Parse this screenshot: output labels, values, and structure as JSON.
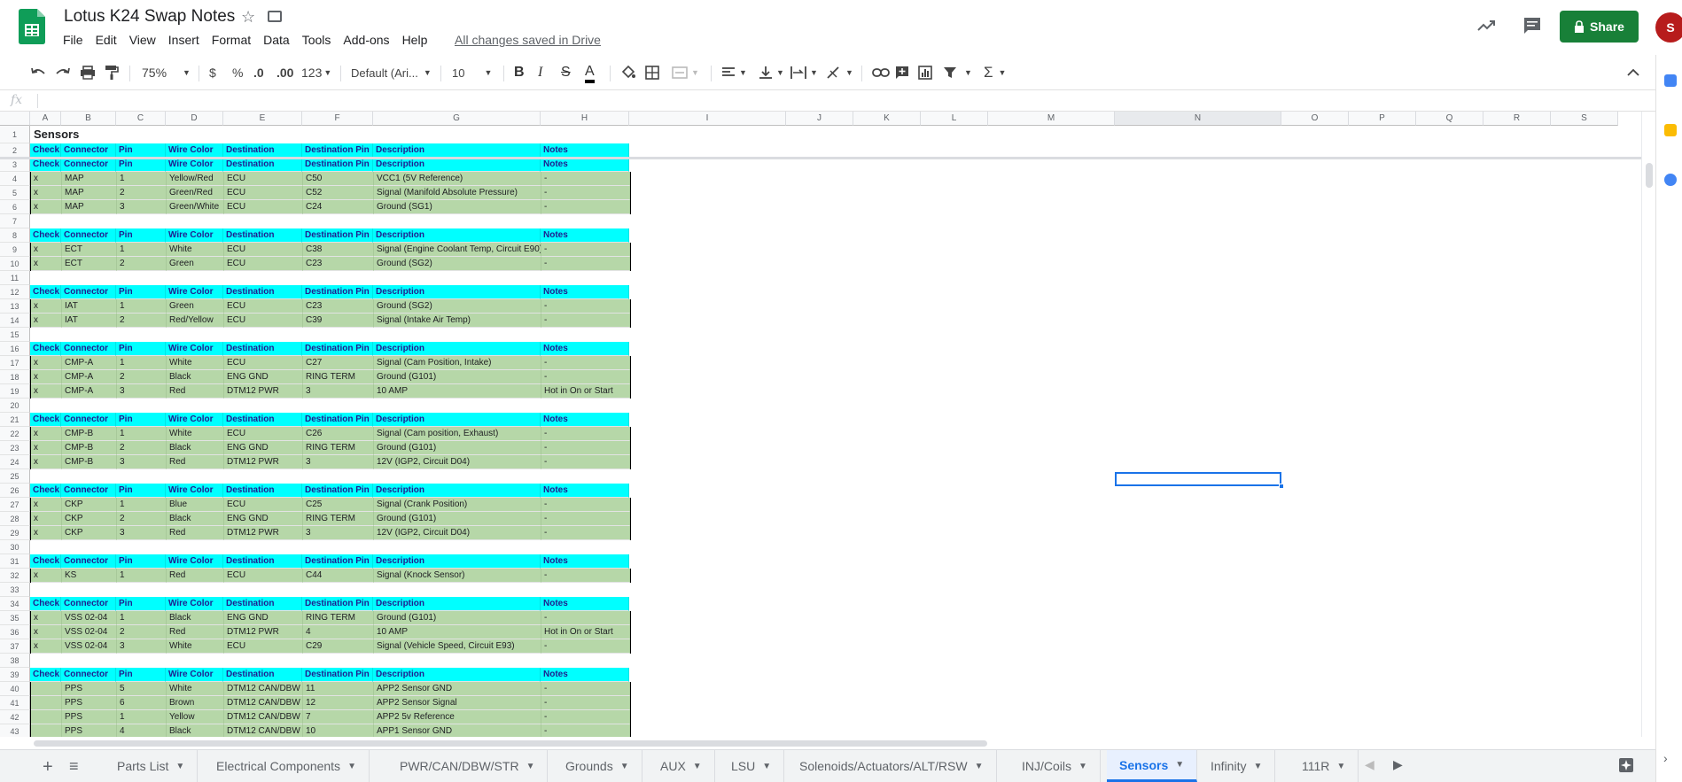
{
  "doc": {
    "title": "Lotus K24 Swap Notes",
    "saved_status": "All changes saved in Drive",
    "share_label": "Share",
    "avatar_initials": "S"
  },
  "menu": [
    "File",
    "Edit",
    "View",
    "Insert",
    "Format",
    "Data",
    "Tools",
    "Add-ons",
    "Help"
  ],
  "toolbar": {
    "zoom": "75%",
    "currency": "$",
    "percent": "%",
    "dec_less": ".0",
    "dec_more": ".00",
    "more_formats": "123",
    "font": "Default (Ari...",
    "font_size": "10",
    "bold": "B",
    "italic": "I",
    "strike": "S",
    "text_color": "A"
  },
  "formula_bar": {
    "fx": "fx",
    "value": ""
  },
  "columns": [
    "A",
    "B",
    "C",
    "D",
    "E",
    "F",
    "G",
    "H",
    "I",
    "J",
    "K",
    "L",
    "M",
    "N",
    "O",
    "P",
    "Q",
    "R",
    "S"
  ],
  "sheet_title": "Sensors",
  "table_header": [
    "Check",
    "Connector",
    "Pin",
    "Wire Color",
    "Destination",
    "Destination Pin",
    "Description",
    "Notes"
  ],
  "rows": [
    {
      "n": 1,
      "type": "title"
    },
    {
      "n": 2,
      "type": "hdr"
    },
    {
      "n": 3,
      "type": "hdr"
    },
    {
      "n": 4,
      "type": "dat",
      "cells": [
        "x",
        "MAP",
        "1",
        "Yellow/Red",
        "ECU",
        "C50",
        "VCC1 (5V Reference)",
        "-"
      ]
    },
    {
      "n": 5,
      "type": "dat",
      "cells": [
        "x",
        "MAP",
        "2",
        "Green/Red",
        "ECU",
        "C52",
        "Signal (Manifold Absolute Pressure)",
        "-"
      ]
    },
    {
      "n": 6,
      "type": "dat",
      "cells": [
        "x",
        "MAP",
        "3",
        "Green/White",
        "ECU",
        "C24",
        "Ground (SG1)",
        "-"
      ]
    },
    {
      "n": 7,
      "type": "blank"
    },
    {
      "n": 8,
      "type": "hdr"
    },
    {
      "n": 9,
      "type": "dat",
      "cells": [
        "x",
        "ECT",
        "1",
        "White",
        "ECU",
        "C38",
        "Signal (Engine Coolant Temp, Circuit E90)",
        "-"
      ]
    },
    {
      "n": 10,
      "type": "dat",
      "cells": [
        "x",
        "ECT",
        "2",
        "Green",
        "ECU",
        "C23",
        "Ground (SG2)",
        "-"
      ]
    },
    {
      "n": 11,
      "type": "blank"
    },
    {
      "n": 12,
      "type": "hdr"
    },
    {
      "n": 13,
      "type": "dat",
      "cells": [
        "x",
        "IAT",
        "1",
        "Green",
        "ECU",
        "C23",
        "Ground (SG2)",
        "-"
      ]
    },
    {
      "n": 14,
      "type": "dat",
      "cells": [
        "x",
        "IAT",
        "2",
        "Red/Yellow",
        "ECU",
        "C39",
        "Signal (Intake Air Temp)",
        "-"
      ]
    },
    {
      "n": 15,
      "type": "blank"
    },
    {
      "n": 16,
      "type": "hdr"
    },
    {
      "n": 17,
      "type": "dat",
      "cells": [
        "x",
        "CMP-A",
        "1",
        "White",
        "ECU",
        "C27",
        "Signal (Cam Position, Intake)",
        "-"
      ]
    },
    {
      "n": 18,
      "type": "dat",
      "cells": [
        "x",
        "CMP-A",
        "2",
        "Black",
        "ENG GND",
        "RING TERM",
        "Ground (G101)",
        "-"
      ]
    },
    {
      "n": 19,
      "type": "dat",
      "cells": [
        "x",
        "CMP-A",
        "3",
        "Red",
        "DTM12 PWR",
        "3",
        "10 AMP",
        "Hot in On or Start"
      ]
    },
    {
      "n": 20,
      "type": "blank"
    },
    {
      "n": 21,
      "type": "hdr"
    },
    {
      "n": 22,
      "type": "dat",
      "cells": [
        "x",
        "CMP-B",
        "1",
        "White",
        "ECU",
        "C26",
        "Signal (Cam position, Exhaust)",
        "-"
      ]
    },
    {
      "n": 23,
      "type": "dat",
      "cells": [
        "x",
        "CMP-B",
        "2",
        "Black",
        "ENG GND",
        "RING TERM",
        "Ground (G101)",
        "-"
      ]
    },
    {
      "n": 24,
      "type": "dat",
      "cells": [
        "x",
        "CMP-B",
        "3",
        "Red",
        "DTM12 PWR",
        "3",
        "12V (IGP2, Circuit D04)",
        "-"
      ]
    },
    {
      "n": 25,
      "type": "blank"
    },
    {
      "n": 26,
      "type": "hdr"
    },
    {
      "n": 27,
      "type": "dat",
      "cells": [
        "x",
        "CKP",
        "1",
        "Blue",
        "ECU",
        "C25",
        "Signal (Crank Position)",
        "-"
      ]
    },
    {
      "n": 28,
      "type": "dat",
      "cells": [
        "x",
        "CKP",
        "2",
        "Black",
        "ENG GND",
        "RING TERM",
        "Ground (G101)",
        "-"
      ]
    },
    {
      "n": 29,
      "type": "dat",
      "cells": [
        "x",
        "CKP",
        "3",
        "Red",
        "DTM12 PWR",
        "3",
        "12V (IGP2, Circuit D04)",
        "-"
      ]
    },
    {
      "n": 30,
      "type": "blank"
    },
    {
      "n": 31,
      "type": "hdr"
    },
    {
      "n": 32,
      "type": "dat",
      "cells": [
        "x",
        "KS",
        "1",
        "Red",
        "ECU",
        "C44",
        "Signal (Knock Sensor)",
        "-"
      ]
    },
    {
      "n": 33,
      "type": "blank"
    },
    {
      "n": 34,
      "type": "hdr"
    },
    {
      "n": 35,
      "type": "dat",
      "cells": [
        "x",
        "VSS 02-04",
        "1",
        "Black",
        "ENG GND",
        "RING TERM",
        "Ground (G101)",
        "-"
      ]
    },
    {
      "n": 36,
      "type": "dat",
      "cells": [
        "x",
        "VSS 02-04",
        "2",
        "Red",
        "DTM12 PWR",
        "4",
        "10 AMP",
        "Hot in On or Start"
      ]
    },
    {
      "n": 37,
      "type": "dat",
      "cells": [
        "x",
        "VSS 02-04",
        "3",
        "White",
        "ECU",
        "C29",
        "Signal (Vehicle Speed, Circuit E93)",
        "-"
      ]
    },
    {
      "n": 38,
      "type": "blank"
    },
    {
      "n": 39,
      "type": "hdr"
    },
    {
      "n": 40,
      "type": "dat",
      "cells": [
        "",
        "PPS",
        "5",
        "White",
        "DTM12 CAN/DBW",
        "11",
        "APP2 Sensor GND",
        "-"
      ]
    },
    {
      "n": 41,
      "type": "dat",
      "cells": [
        "",
        "PPS",
        "6",
        "Brown",
        "DTM12 CAN/DBW",
        "12",
        "APP2 Sensor Signal",
        "-"
      ]
    },
    {
      "n": 42,
      "type": "dat",
      "cells": [
        "",
        "PPS",
        "1",
        "Yellow",
        "DTM12 CAN/DBW",
        "7",
        "APP2 5v Reference",
        "-"
      ]
    },
    {
      "n": 43,
      "type": "dat",
      "cells": [
        "",
        "PPS",
        "4",
        "Black",
        "DTM12 CAN/DBW",
        "10",
        "APP1 Sensor GND",
        "-"
      ]
    }
  ],
  "tabs": [
    {
      "label": "Parts List",
      "active": false
    },
    {
      "label": "Electrical Components",
      "active": false
    },
    {
      "label": "PWR/CAN/DBW/STR",
      "active": false
    },
    {
      "label": "Grounds",
      "active": false
    },
    {
      "label": "AUX",
      "active": false
    },
    {
      "label": "LSU",
      "active": false
    },
    {
      "label": "Solenoids/Actuators/ALT/RSW",
      "active": false
    },
    {
      "label": "INJ/Coils",
      "active": false
    },
    {
      "label": "Sensors",
      "active": true
    },
    {
      "label": "Infinity",
      "active": false
    },
    {
      "label": "111R",
      "active": false
    }
  ],
  "colors": {
    "header_fill": "#00ffff",
    "data_fill": "#b6d7a8",
    "share_green": "#188038",
    "selection_blue": "#1a73e8"
  }
}
